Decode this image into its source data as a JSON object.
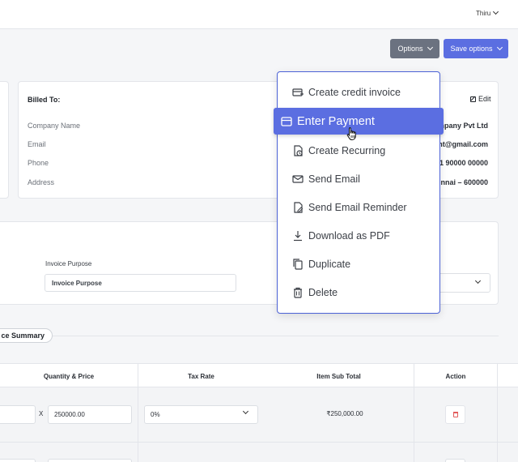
{
  "header": {
    "user_name": "Thiru"
  },
  "toolbar": {
    "options_label": "Options",
    "save_options_label": "Save options"
  },
  "billed_to": {
    "title": "Billed To:",
    "edit_label": "Edit",
    "fields": [
      {
        "label": "Company Name",
        "value": "mpany Pvt Ltd"
      },
      {
        "label": "Email",
        "value": "nt@gmail.com"
      },
      {
        "label": "Phone",
        "value": "1 90000 00000"
      },
      {
        "label": "Address",
        "value": "nnai – 600000"
      }
    ]
  },
  "invoice_info": {
    "purpose_label": "Invoice Purpose",
    "purpose_value": "Invoice Purpose"
  },
  "summary": {
    "pill_label": "ce Summary"
  },
  "items_table": {
    "columns": [
      "Quantity & Price",
      "Tax Rate",
      "Item Sub Total",
      "Action"
    ],
    "rows": [
      {
        "quantity": "",
        "times": "X",
        "price": "250000.00",
        "tax_rate": "0%",
        "sub_total": "₹250,000.00"
      }
    ]
  },
  "options_menu": {
    "items": [
      {
        "label": "Create credit invoice",
        "icon": "credit-invoice-icon"
      },
      {
        "label": "Enter Payment",
        "icon": "credit-card-icon",
        "active": true
      },
      {
        "label": "Create Recurring",
        "icon": "recurring-icon"
      },
      {
        "label": "Send Email",
        "icon": "mail-icon"
      },
      {
        "label": "Send Email Reminder",
        "icon": "reminder-icon"
      },
      {
        "label": "Download as PDF",
        "icon": "download-icon"
      },
      {
        "label": "Duplicate",
        "icon": "duplicate-icon"
      },
      {
        "label": "Delete",
        "icon": "trash-icon"
      }
    ]
  },
  "colors": {
    "accent": "#5b6ee1",
    "options_button": "#6b7280",
    "delete": "#e25c5c"
  }
}
